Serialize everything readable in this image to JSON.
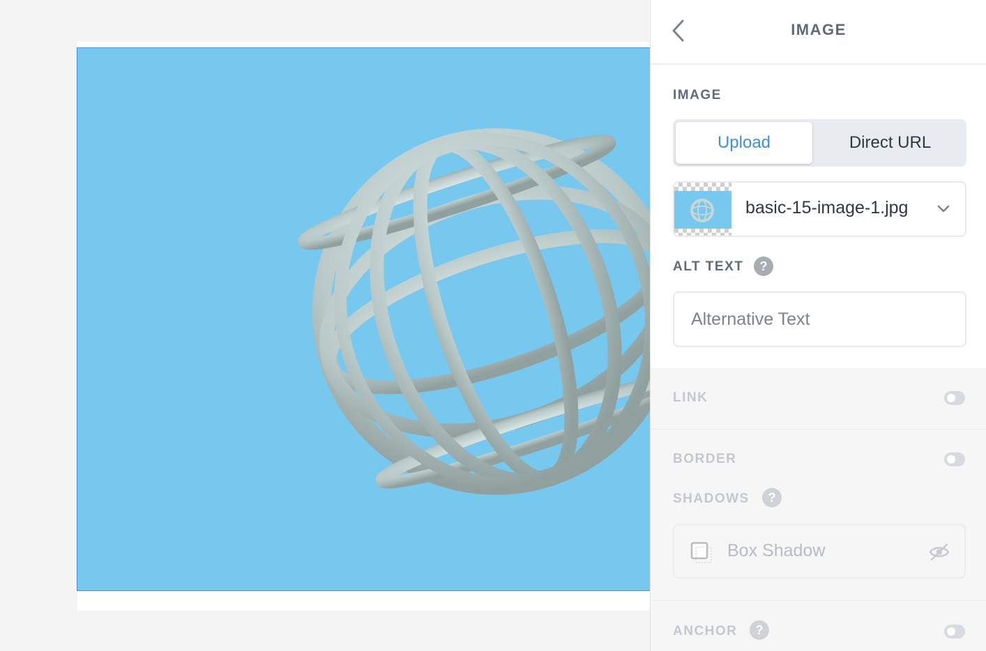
{
  "panel": {
    "title": "IMAGE",
    "image_section": {
      "label": "IMAGE",
      "tabs": [
        "Upload",
        "Direct URL"
      ],
      "active_tab": "Upload",
      "file_name": "basic-15-image-1.jpg",
      "alt_text_label": "ALT TEXT",
      "alt_text_placeholder": "Alternative Text",
      "alt_text_value": ""
    },
    "link": {
      "label": "LINK",
      "enabled": false
    },
    "border": {
      "label": "BORDER",
      "enabled": false
    },
    "shadows": {
      "label": "SHADOWS",
      "box_shadow_label": "Box Shadow",
      "box_shadow_checked": false
    },
    "anchor": {
      "label": "ANCHOR",
      "enabled": false
    },
    "help_glyph": "?"
  },
  "colors": {
    "image_background": "#76c8ee",
    "accent": "#3d8fd9",
    "selection_border": "#4a90e2"
  },
  "icons": [
    "back-chevron-icon",
    "help-icon",
    "chevron-down-icon",
    "checkbox-icon",
    "eye-slash-icon",
    "toggle-switch"
  ]
}
